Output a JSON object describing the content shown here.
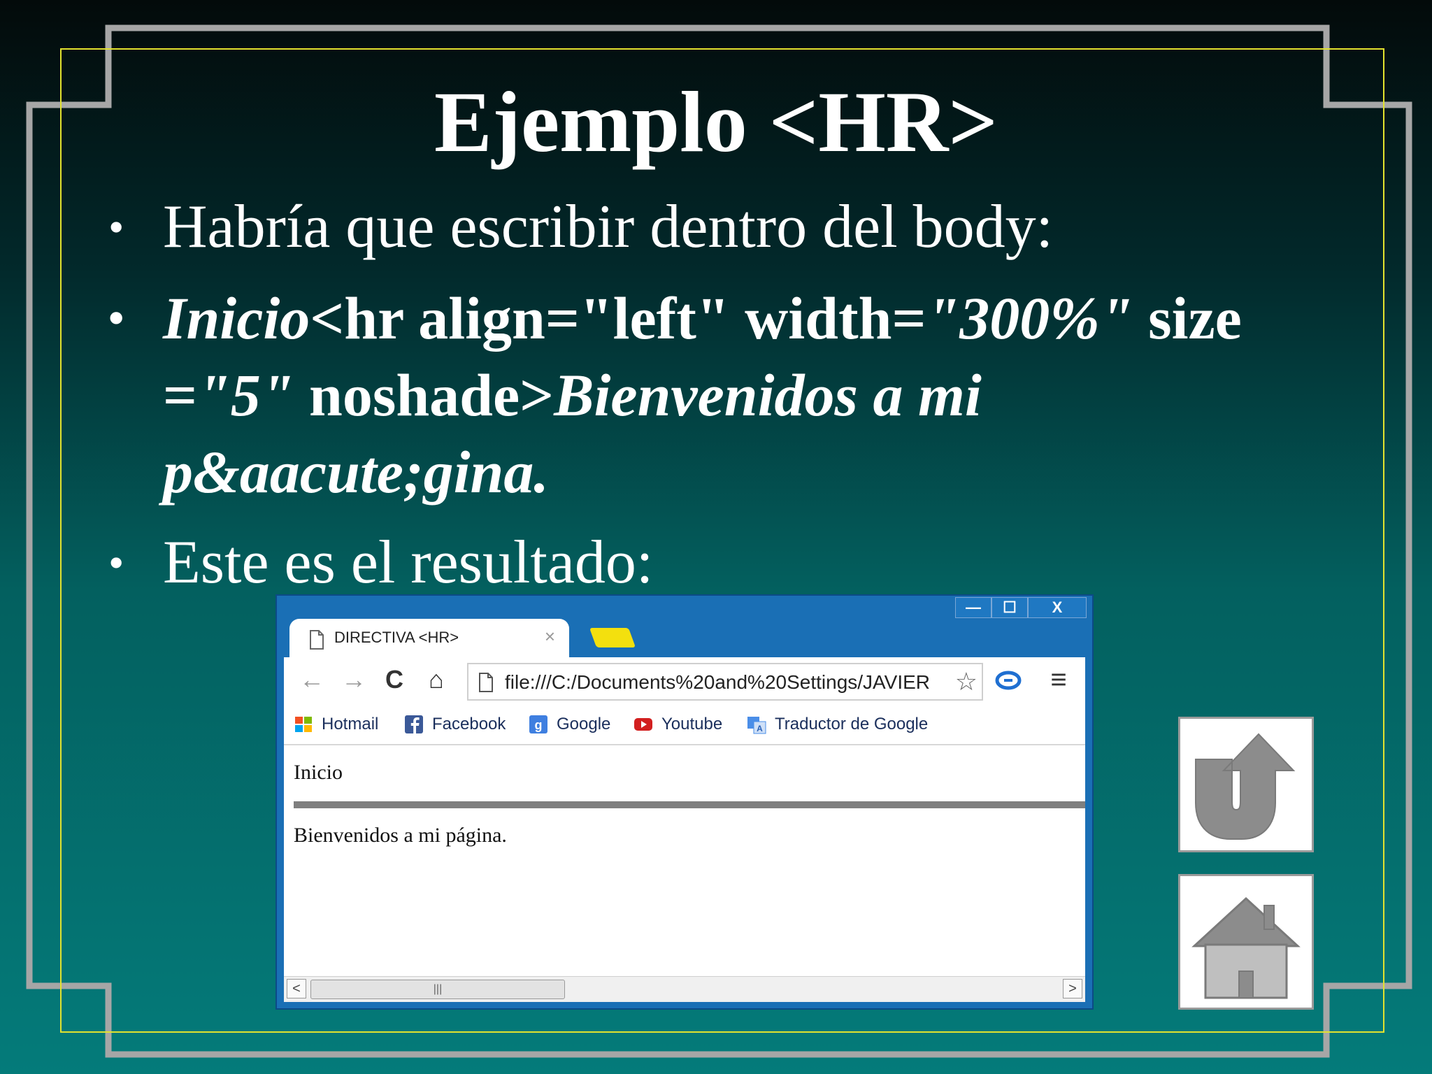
{
  "slide": {
    "title": "Ejemplo <HR>",
    "bullets": [
      {
        "text": "Habría que escribir dentro del body:"
      },
      {
        "parts": [
          {
            "text": "Inicio",
            "italic": true
          },
          {
            "text": "<hr align=\"left\" width=",
            "italic": false
          },
          {
            "text": "\"300%\"",
            "italic": true
          },
          {
            "text": " size =",
            "italic": false
          },
          {
            "text": "\"5\"",
            "italic": true
          },
          {
            "text": " noshade>",
            "italic": false
          },
          {
            "text": "Bienvenidos a mi p&aacute;gina.",
            "italic": true
          }
        ]
      },
      {
        "text": "Este es el resultado:"
      }
    ],
    "colors": {
      "frame": "#a6a6a6",
      "inner_frame": "#e2e22e",
      "text": "#ffffff"
    }
  },
  "browser": {
    "tab_title": "DIRECTIVA <HR>",
    "tab_close": "×",
    "window_buttons": {
      "minimize": "—",
      "maximize": "☐",
      "close": "X"
    },
    "nav": {
      "back": "←",
      "forward": "→",
      "reload": "C",
      "home": "⌂"
    },
    "url": "file:///C:/Documents%20and%20Settings/JAVIER",
    "star": "☆",
    "menu": "≡",
    "bookmarks": [
      {
        "label": "Hotmail",
        "icon": "windows-flag-icon"
      },
      {
        "label": "Facebook",
        "icon": "facebook-icon"
      },
      {
        "label": "Google",
        "icon": "google-icon"
      },
      {
        "label": "Youtube",
        "icon": "youtube-icon"
      },
      {
        "label": "Traductor de Google",
        "icon": "translate-icon"
      }
    ],
    "content": {
      "line1": "Inicio",
      "line2": "Bienvenidos a mi página."
    },
    "scroll": {
      "left": "<",
      "right": ">",
      "thumb": "|||"
    },
    "colors": {
      "chrome": "#1a6fb5",
      "new_tab": "#f3e00e",
      "hr": "#7f7f7f"
    }
  },
  "side_buttons": [
    {
      "icon": "return-arrow-icon"
    },
    {
      "icon": "home-icon"
    }
  ]
}
